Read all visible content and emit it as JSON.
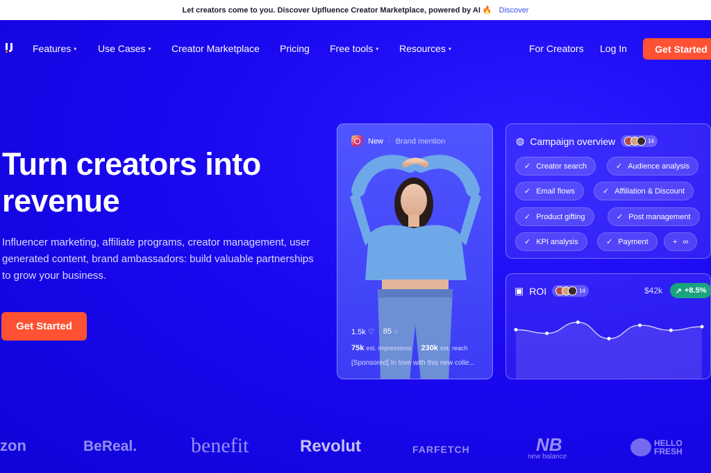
{
  "announcement": {
    "text": "Let creators come to you. Discover Upfluence Creator Marketplace, powered by AI 🔥",
    "link": "Discover"
  },
  "nav": {
    "features": "Features",
    "use_cases": "Use Cases",
    "creator_marketplace": "Creator Marketplace",
    "pricing": "Pricing",
    "free_tools": "Free tools",
    "resources": "Resources",
    "for_creators": "For Creators",
    "login": "Log In",
    "cta": "Get Started"
  },
  "hero": {
    "title": "Turn creators into revenue",
    "subtitle": "Influencer marketing, affiliate programs, creator management, user generated content, brand ambassadors: build valuable partnerships to grow your business.",
    "cta": "Get Started"
  },
  "post_card": {
    "badge": "New",
    "type": "Brand mention",
    "likes": "1.5k",
    "comments": "85",
    "impressions": "75k",
    "impressions_label": "est. impressions",
    "reach": "230k",
    "reach_label": "est. reach",
    "caption": "[Sponsored] In love with this new colle..."
  },
  "campaign_overview": {
    "title": "Campaign overview",
    "avatar_count": "14",
    "pills": [
      "Creator search",
      "Audience analysis",
      "Email flows",
      "Affiliation & Discount",
      "Product gifting",
      "Post management",
      "KPI analysis",
      "Payment",
      "∞"
    ]
  },
  "roi": {
    "title": "ROI",
    "avatar_count": "14",
    "value": "$42k",
    "change": "+8.5%",
    "trend": [
      0.44,
      0.31,
      0.71,
      0.12,
      0.6,
      0.42,
      0.55
    ]
  },
  "brands": [
    "zon",
    "BeReal.",
    "benefit",
    "Revolut",
    "FARFETCH",
    "new balance",
    "HELLO FRESH"
  ],
  "colors": {
    "primary_bg": "#1206e6",
    "accent": "#ff5133",
    "badge_green": "#19a37e"
  }
}
